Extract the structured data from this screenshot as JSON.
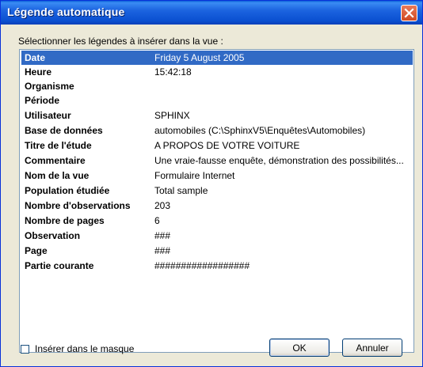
{
  "window": {
    "title": "Légende automatique"
  },
  "prompt": "Sélectionner les légendes à insérer dans la vue :",
  "rows": [
    {
      "label": "Date",
      "value": "Friday 5 August 2005"
    },
    {
      "label": "Heure",
      "value": "15:42:18"
    },
    {
      "label": "Organisme",
      "value": ""
    },
    {
      "label": "Période",
      "value": ""
    },
    {
      "label": "Utilisateur",
      "value": "SPHINX"
    },
    {
      "label": "Base de données",
      "value": "automobiles (C:\\SphinxV5\\Enquêtes\\Automobiles)"
    },
    {
      "label": "Titre de l'étude",
      "value": "A PROPOS DE VOTRE VOITURE"
    },
    {
      "label": "Commentaire",
      "value": "Une vraie-fausse enquête, démonstration des possibilités..."
    },
    {
      "label": "Nom de la vue",
      "value": "Formulaire Internet"
    },
    {
      "label": "Population étudiée",
      "value": "Total sample"
    },
    {
      "label": "Nombre d'observations",
      "value": "203"
    },
    {
      "label": "Nombre de pages",
      "value": "6"
    },
    {
      "label": "Observation",
      "value": "###"
    },
    {
      "label": "Page",
      "value": "###"
    },
    {
      "label": "Partie courante",
      "value": "##################"
    }
  ],
  "selected_row": "Date",
  "checkbox": {
    "label": "Insérer dans le masque",
    "checked": false
  },
  "buttons": {
    "ok": "OK",
    "cancel": "Annuler"
  },
  "colors": {
    "title_bar": "#0a4fd0",
    "selection": "#316ac5",
    "close_button": "#d04a22"
  },
  "icons": {
    "close": "close-icon"
  }
}
